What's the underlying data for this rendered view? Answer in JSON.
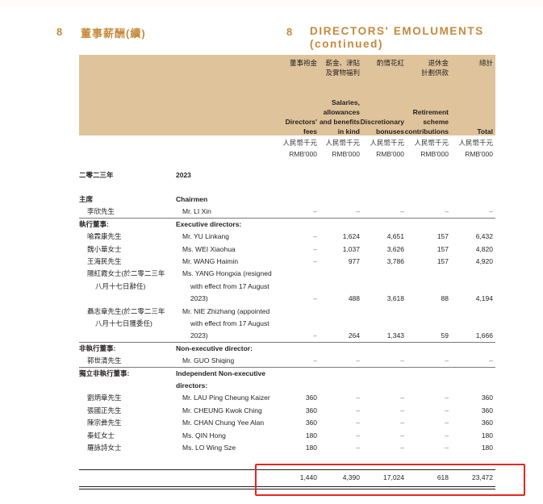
{
  "section": {
    "number_left": "8",
    "title_cn": "董事薪酬(續)",
    "number_right": "8",
    "title_en_line1": "DIRECTORS' EMOLUMENTS",
    "title_en_line2": "(continued)"
  },
  "columns": [
    {
      "cn": [
        "董事袍金"
      ],
      "en": [
        "Directors'",
        "fees"
      ],
      "unit_cn": "人民幣千元",
      "unit_en": "RMB'000"
    },
    {
      "cn": [
        "薪金、津貼",
        "及實物福利"
      ],
      "en": [
        "Salaries,",
        "allowances",
        "and benefits",
        "in kind"
      ],
      "unit_cn": "人民幣千元",
      "unit_en": "RMB'000"
    },
    {
      "cn": [
        "酌情花紅"
      ],
      "en": [
        "Discretionary",
        "bonuses"
      ],
      "unit_cn": "人民幣千元",
      "unit_en": "RMB'000"
    },
    {
      "cn": [
        "退休金",
        "計劃供款"
      ],
      "en": [
        "Retirement",
        "scheme",
        "contributions"
      ],
      "unit_cn": "人民幣千元",
      "unit_en": "RMB'000"
    },
    {
      "cn": [
        "總計"
      ],
      "en": [
        "Total"
      ],
      "unit_cn": "人民幣千元",
      "unit_en": "RMB'000"
    }
  ],
  "year": {
    "cn": "二零二三年",
    "en": "2023"
  },
  "groups": [
    {
      "cn": "主席",
      "en": "Chairmen",
      "rows": [
        {
          "cn": [
            "李欣先生"
          ],
          "en": [
            "Mr. LI Xin"
          ],
          "values": [
            "–",
            "–",
            "–",
            "–",
            "–"
          ]
        }
      ]
    },
    {
      "cn": "執行董事:",
      "en": "Executive directors:",
      "rows": [
        {
          "cn": [
            "喻霖康先生"
          ],
          "en": [
            "Mr. YU Linkang"
          ],
          "values": [
            "–",
            "1,624",
            "4,651",
            "157",
            "6,432"
          ]
        },
        {
          "cn": [
            "魏小華女士"
          ],
          "en": [
            "Ms. WEI Xiaohua"
          ],
          "values": [
            "–",
            "1,037",
            "3,626",
            "157",
            "4,820"
          ]
        },
        {
          "cn": [
            "王海民先生"
          ],
          "en": [
            "Mr. WANG Haimin"
          ],
          "values": [
            "–",
            "977",
            "3,786",
            "157",
            "4,920"
          ]
        },
        {
          "cn": [
            "陽紅霞女士(於二零二三年",
            "八月十七日辭任)"
          ],
          "en": [
            "Ms. YANG Hongxia (resigned",
            "with effect from 17 August",
            "2023)"
          ],
          "values": [
            "–",
            "488",
            "3,618",
            "88",
            "4,194"
          ]
        },
        {
          "cn": [
            "聶志章先生(於二零二三年",
            "八月十七日獲委任)"
          ],
          "en": [
            "Mr. NIE Zhizhang (appointed",
            "with effect from 17 August",
            "2023)"
          ],
          "values": [
            "–",
            "264",
            "1,343",
            "59",
            "1,666"
          ]
        }
      ]
    },
    {
      "cn": "非執行董事:",
      "en": "Non-executive director:",
      "rows": [
        {
          "cn": [
            "郭世清先生"
          ],
          "en": [
            "Mr. GUO Shiqing"
          ],
          "values": [
            "–",
            "–",
            "–",
            "–",
            "–"
          ]
        }
      ]
    },
    {
      "cn": "獨立非執行董事:",
      "en": "Independent Non-executive directors:",
      "rows": [
        {
          "cn": [
            "劉炳章先生"
          ],
          "en": [
            "Mr. LAU Ping Cheung Kaizer"
          ],
          "values": [
            "360",
            "–",
            "–",
            "–",
            "360"
          ]
        },
        {
          "cn": [
            "張國正先生"
          ],
          "en": [
            "Mr. CHEUNG Kwok Ching"
          ],
          "values": [
            "360",
            "–",
            "–",
            "–",
            "360"
          ]
        },
        {
          "cn": [
            "陳宗彝先生"
          ],
          "en": [
            "Mr. CHAN Chung Yee Alan"
          ],
          "values": [
            "360",
            "–",
            "–",
            "–",
            "360"
          ]
        },
        {
          "cn": [
            "秦虹女士"
          ],
          "en": [
            "Ms. QIN Hong"
          ],
          "values": [
            "180",
            "–",
            "–",
            "–",
            "180"
          ]
        },
        {
          "cn": [
            "羅詠詩女士"
          ],
          "en": [
            "Ms. LO Wing Sze"
          ],
          "values": [
            "180",
            "–",
            "–",
            "–",
            "180"
          ]
        }
      ]
    }
  ],
  "totals": [
    "1,440",
    "4,390",
    "17,024",
    "618",
    "23,472"
  ],
  "colors": {
    "accent": "#c6893a",
    "header_bg": "#dfc39b",
    "highlight_box": "#e8261f"
  }
}
